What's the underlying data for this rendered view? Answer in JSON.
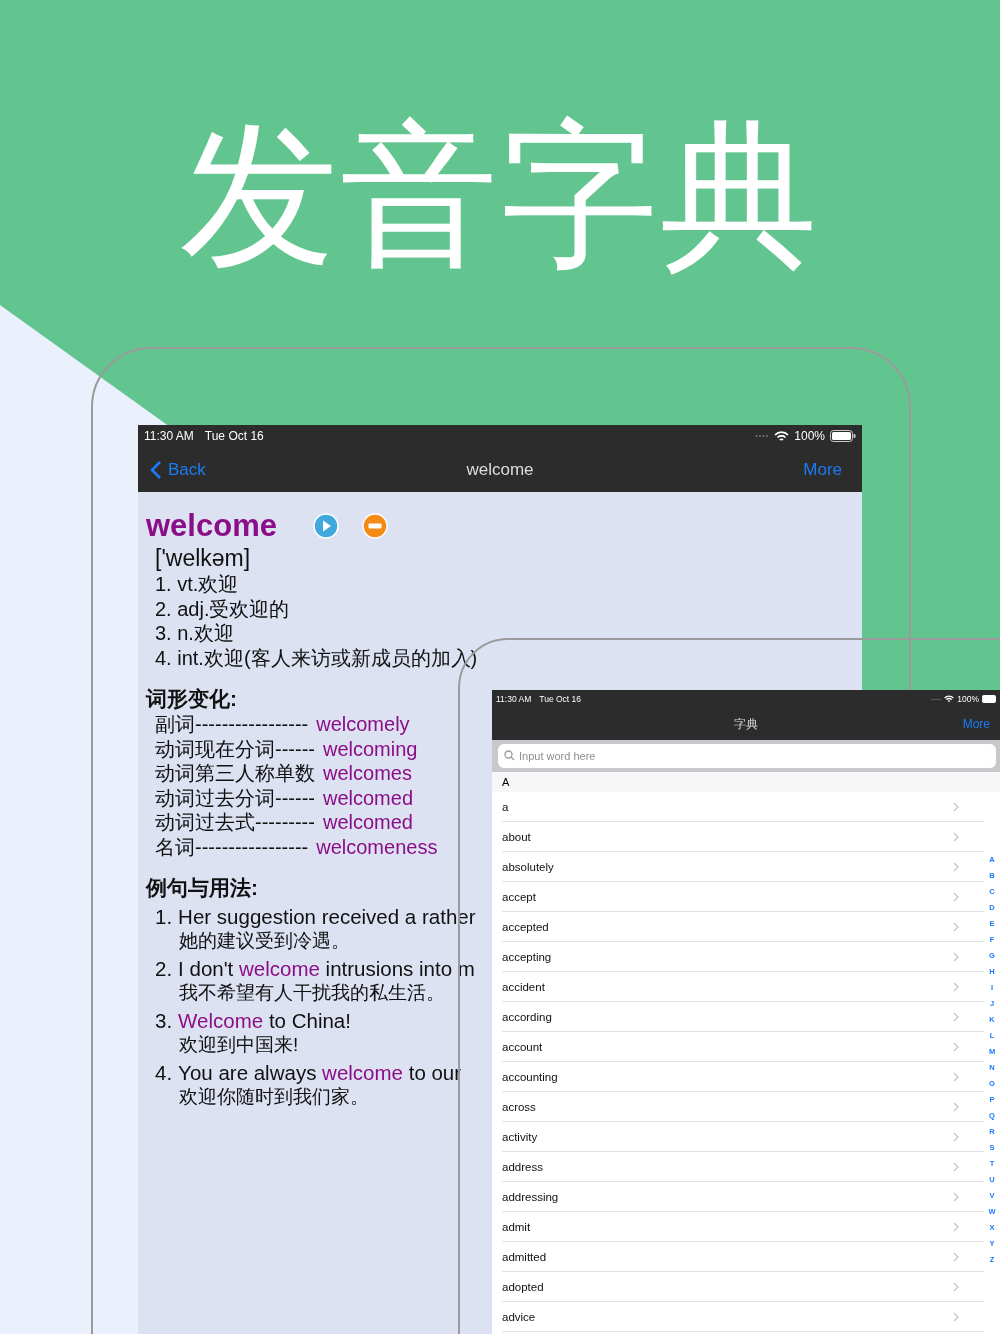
{
  "headline": "发音字典",
  "detail_screen": {
    "status_bar": {
      "time": "11:30 AM",
      "date": "Tue Oct 16",
      "battery": "100%"
    },
    "nav": {
      "back": "Back",
      "title": "welcome",
      "more": "More"
    },
    "word": "welcome",
    "phonetic": "['welkəm]",
    "meanings": [
      "1. vt.欢迎",
      "2. adj.受欢迎的",
      "3. n.欢迎",
      "4. int.欢迎(客人来访或新成员的加入)"
    ],
    "forms_heading": "词形变化:",
    "forms": [
      {
        "label": "副词-----------------",
        "value": "welcomely"
      },
      {
        "label": "动词现在分词------",
        "value": "welcoming"
      },
      {
        "label": "动词第三人称单数",
        "value": "welcomes"
      },
      {
        "label": "动词过去分词------",
        "value": "welcomed"
      },
      {
        "label": "动词过去式---------",
        "value": "welcomed"
      },
      {
        "label": "名词-----------------",
        "value": "welcomeness"
      }
    ],
    "examples_heading": "例句与用法:",
    "examples": [
      {
        "number": "1.",
        "parts": [
          {
            "text": "Her suggestion received a rather",
            "highlight": false
          }
        ],
        "translation": "她的建议受到冷遇。"
      },
      {
        "number": "2.",
        "parts": [
          {
            "text": "I don't ",
            "highlight": false
          },
          {
            "text": "welcome",
            "highlight": true
          },
          {
            "text": " intrusions into m",
            "highlight": false
          }
        ],
        "translation": "我不希望有人干扰我的私生活。"
      },
      {
        "number": "3.",
        "parts": [
          {
            "text": "Welcome",
            "highlight": true
          },
          {
            "text": " to China!",
            "highlight": false
          }
        ],
        "translation": "欢迎到中国来!"
      },
      {
        "number": "4.",
        "parts": [
          {
            "text": "You are always ",
            "highlight": false
          },
          {
            "text": "welcome",
            "highlight": true
          },
          {
            "text": " to our",
            "highlight": false
          }
        ],
        "translation": "欢迎你随时到我们家。"
      }
    ]
  },
  "list_screen": {
    "status_bar": {
      "time": "11:30 AM",
      "date": "Tue Oct 16",
      "battery": "100%"
    },
    "nav": {
      "title": "字典",
      "more": "More"
    },
    "search": {
      "placeholder": "Input word here"
    },
    "section": "A",
    "words": [
      "a",
      "about",
      "absolutely",
      "accept",
      "accepted",
      "accepting",
      "accident",
      "according",
      "account",
      "accounting",
      "across",
      "activity",
      "address",
      "addressing",
      "admit",
      "admitted",
      "adopted",
      "advice"
    ],
    "index": [
      "A",
      "B",
      "C",
      "D",
      "E",
      "F",
      "G",
      "H",
      "I",
      "J",
      "K",
      "L",
      "M",
      "N",
      "O",
      "P",
      "Q",
      "R",
      "S",
      "T",
      "U",
      "V",
      "W",
      "X",
      "Y",
      "Z"
    ]
  }
}
